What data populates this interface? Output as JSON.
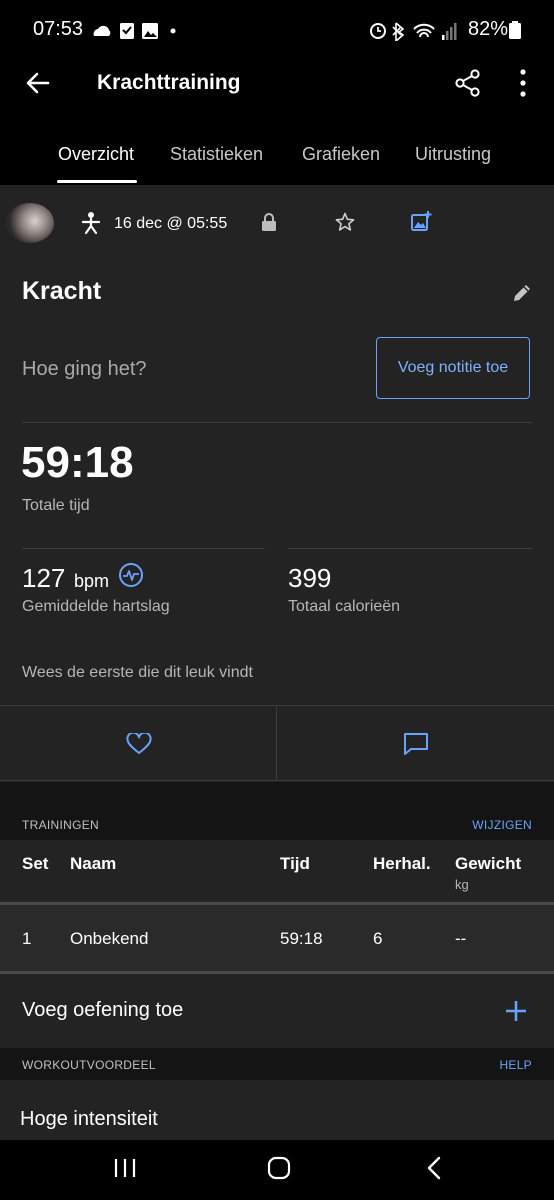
{
  "status": {
    "time": "07:53",
    "battery": "82%"
  },
  "header": {
    "title": "Krachttraining"
  },
  "tabs": [
    "Overzicht",
    "Statistieken",
    "Grafieken",
    "Uitrusting"
  ],
  "activity": {
    "date": "16 dec @ 05:55"
  },
  "workout": {
    "name": "Kracht",
    "feel_prompt": "Hoe ging het?",
    "add_note": "Voeg notitie toe",
    "total_time": "59:18",
    "total_time_label": "Totale tijd",
    "heart_rate": "127",
    "heart_rate_unit": "bpm",
    "heart_rate_label": "Gemiddelde hartslag",
    "calories": "399",
    "calories_label": "Totaal calorieën",
    "like_prompt": "Wees de eerste die dit leuk vindt"
  },
  "trainings": {
    "section_label": "TRAININGEN",
    "edit_label": "WIJZIGEN",
    "columns": [
      "Set",
      "Naam",
      "Tijd",
      "Herhal.",
      "Gewicht"
    ],
    "weight_unit": "kg",
    "rows": [
      {
        "set": "1",
        "name": "Onbekend",
        "time": "59:18",
        "reps": "6",
        "weight": "--"
      }
    ],
    "add_exercise": "Voeg oefening toe"
  },
  "benefit": {
    "section_label": "WORKOUTVOORDEEL",
    "help_label": "HELP",
    "value": "Hoge intensiteit"
  },
  "colors": {
    "accent": "#6aa2ff",
    "background": "#232323",
    "section": "#141414"
  },
  "icons": [
    "back-arrow-icon",
    "share-icon",
    "more-icon",
    "strength-person-icon",
    "lock-icon",
    "star-icon",
    "add-photo-icon",
    "edit-pencil-icon",
    "heart-rate-icon",
    "heart-icon",
    "comment-icon",
    "plus-icon"
  ]
}
